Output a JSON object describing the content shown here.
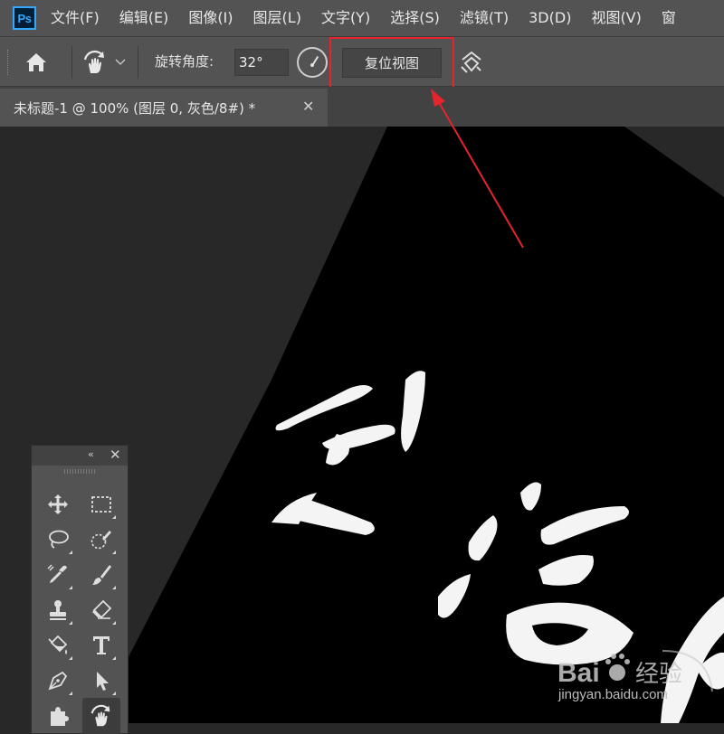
{
  "app": {
    "logo_text": "Ps"
  },
  "menu": {
    "items": [
      "文件(F)",
      "编辑(E)",
      "图像(I)",
      "图层(L)",
      "文字(Y)",
      "选择(S)",
      "滤镜(T)",
      "3D(D)",
      "视图(V)",
      "窗"
    ]
  },
  "options": {
    "home_icon": "home-icon",
    "rotate_tool_icon": "rotate-view-icon",
    "rotate_label": "旋转角度:",
    "rotate_value": "32°",
    "reset_label": "复位视图",
    "sync_icon": "rotate-all-windows-icon"
  },
  "document": {
    "tab_title": "未标题-1 @ 100% (图层 0, 灰色/8#) *",
    "close": "✕",
    "rotation_degrees": 32
  },
  "tools_panel": {
    "collapse": "‹‹",
    "close": "✕",
    "tools": [
      "move-icon",
      "rect-marquee-icon",
      "lasso-icon",
      "quick-select-icon",
      "eyedropper-icon",
      "brush-icon",
      "stamp-icon",
      "eraser-icon",
      "paint-bucket-icon",
      "type-icon",
      "pen-icon",
      "path-select-icon",
      "puzzle-icon",
      "rotate-view-icon"
    ]
  },
  "annotation": {
    "color": "#e5242c"
  },
  "watermark": {
    "brand": "Bai 经验",
    "url": "jingyan.baidu.com"
  },
  "colors": {
    "menu_bg": "#535353",
    "canvas_bg": "#282828",
    "image_bg": "#000000",
    "accent": "#31a8ff"
  }
}
